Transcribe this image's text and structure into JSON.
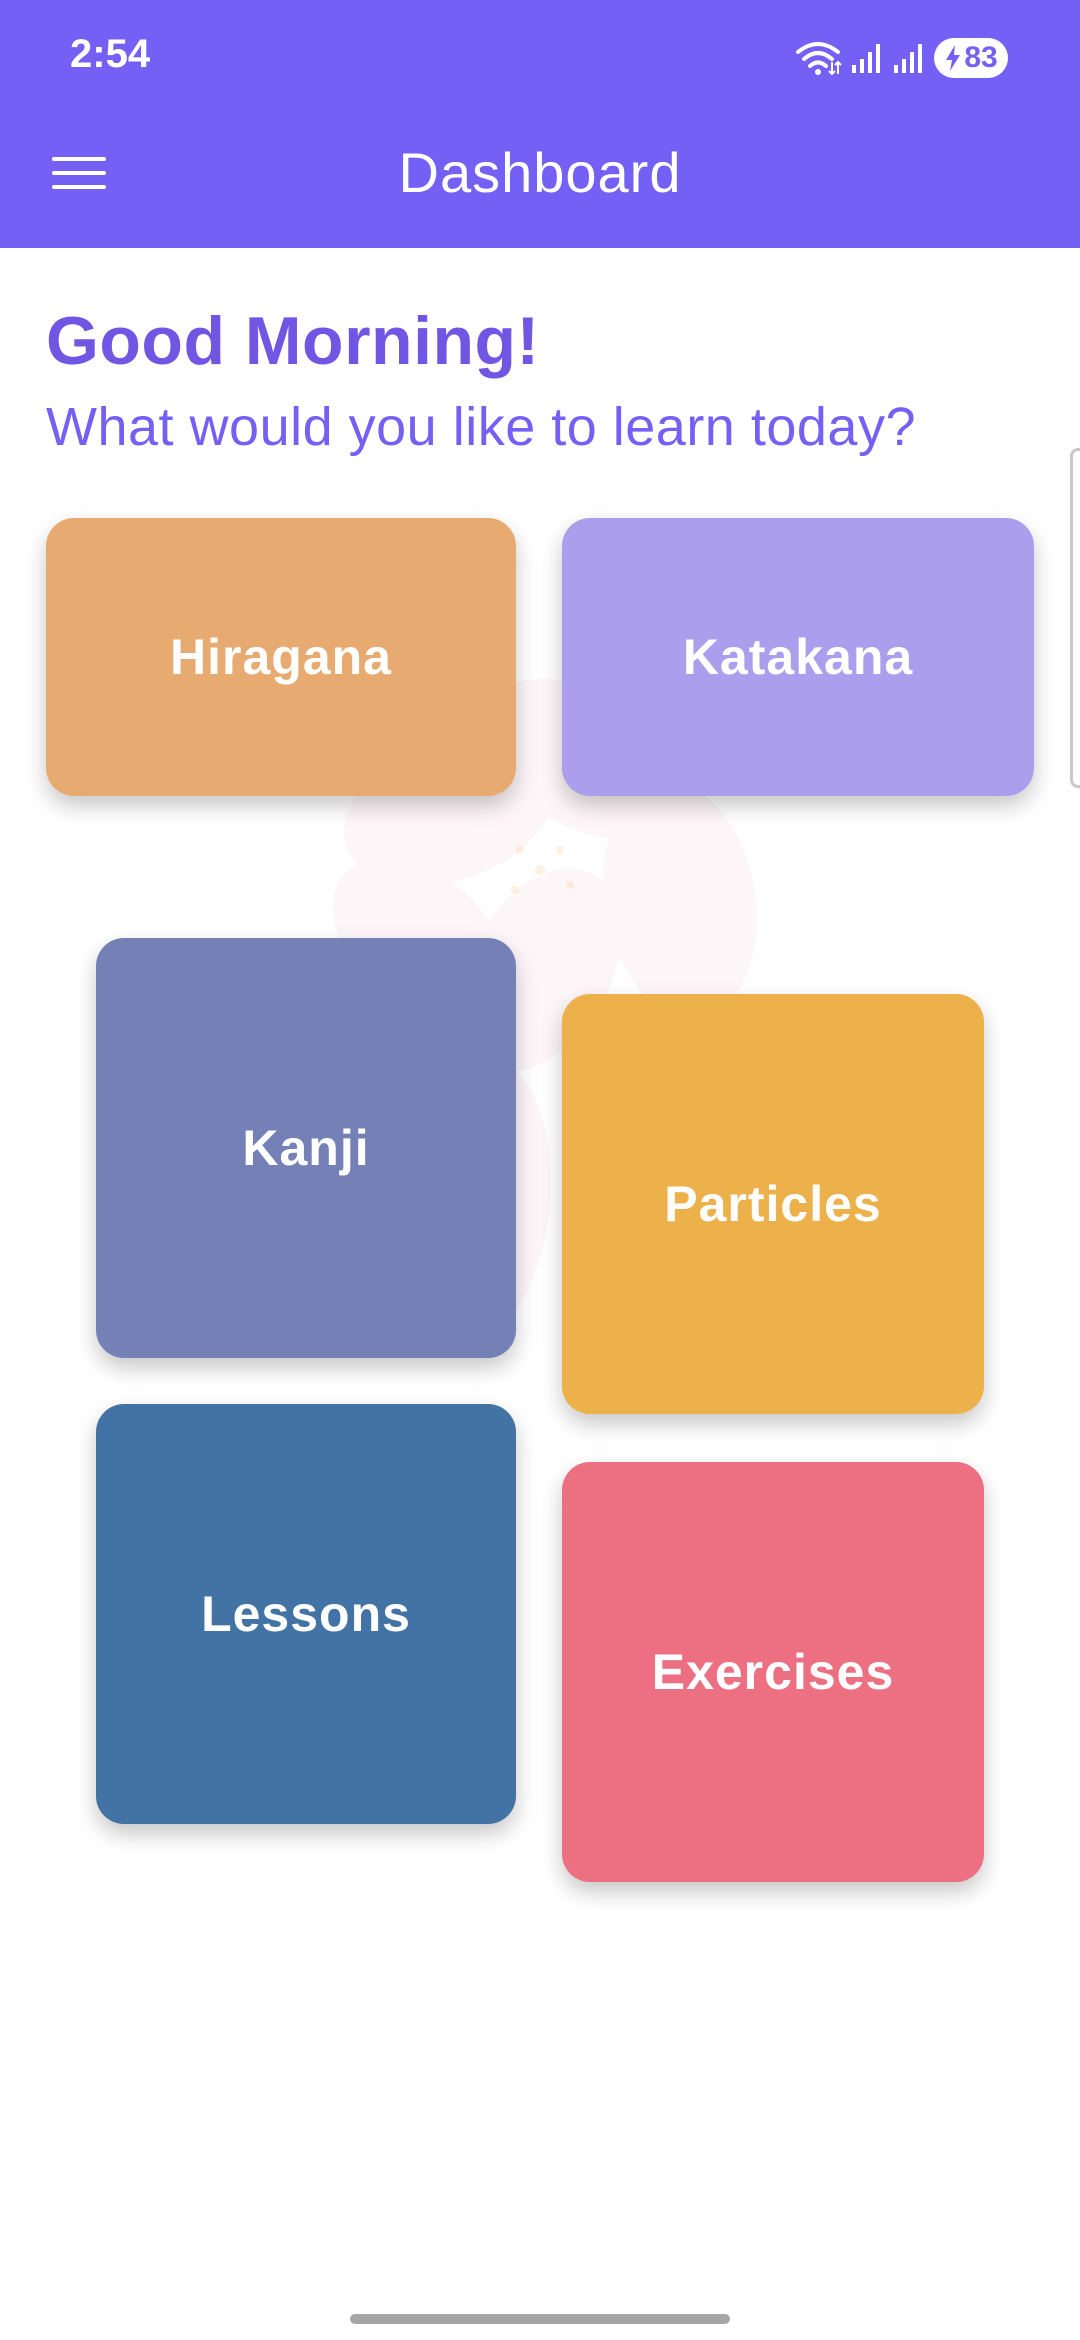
{
  "status_bar": {
    "time": "2:54",
    "battery_level": "83",
    "icons": [
      "wifi-icon",
      "signal-icon",
      "signal-icon",
      "battery-charging-icon"
    ]
  },
  "app_bar": {
    "menu_icon": "hamburger-menu-icon",
    "title": "Dashboard"
  },
  "greeting": {
    "title": "Good Morning!",
    "subtitle": "What would you like to learn today?"
  },
  "tiles": [
    {
      "label": "Hiragana",
      "color": "#e5a465"
    },
    {
      "label": "Katakana",
      "color": "#a597eb"
    },
    {
      "label": "Kanji",
      "color": "#7580b6"
    },
    {
      "label": "Particles",
      "color": "#ecb14a"
    },
    {
      "label": "Lessons",
      "color": "#4373a5"
    },
    {
      "label": "Exercises",
      "color": "#ec7082"
    }
  ],
  "colors": {
    "primary": "#7560f5",
    "accent_text": "#7155e3"
  }
}
